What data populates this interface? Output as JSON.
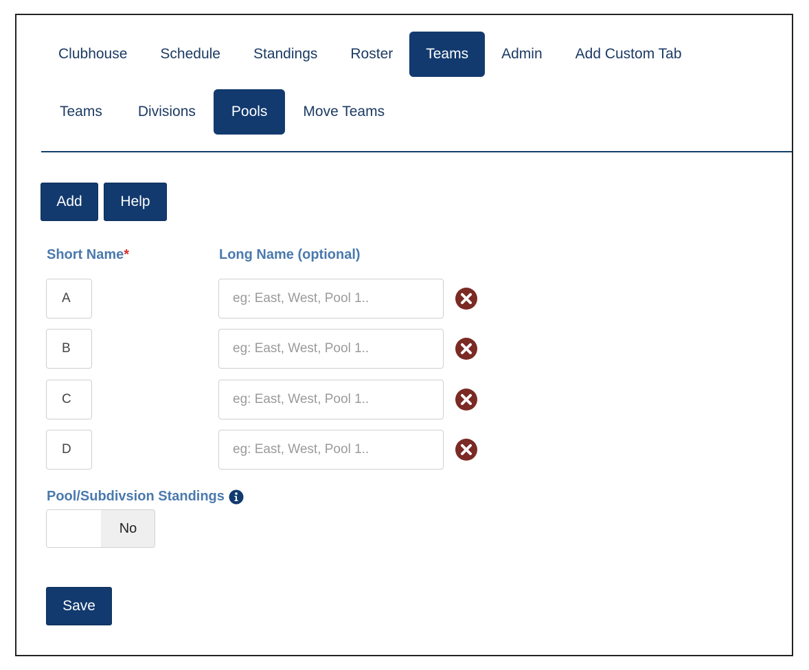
{
  "main_tabs": [
    {
      "label": "Clubhouse",
      "active": false
    },
    {
      "label": "Schedule",
      "active": false
    },
    {
      "label": "Standings",
      "active": false
    },
    {
      "label": "Roster",
      "active": false
    },
    {
      "label": "Teams",
      "active": true
    },
    {
      "label": "Admin",
      "active": false
    },
    {
      "label": "Add Custom Tab",
      "active": false
    }
  ],
  "sub_tabs": [
    {
      "label": "Teams",
      "active": false
    },
    {
      "label": "Divisions",
      "active": false
    },
    {
      "label": "Pools",
      "active": true
    },
    {
      "label": "Move Teams",
      "active": false
    }
  ],
  "toolbar": {
    "add_label": "Add",
    "help_label": "Help"
  },
  "columns": {
    "short_name": "Short Name",
    "required_mark": "*",
    "long_name": "Long Name (optional)"
  },
  "pools": [
    {
      "short": "A",
      "long": "",
      "placeholder": "eg: East, West, Pool 1.."
    },
    {
      "short": "B",
      "long": "",
      "placeholder": "eg: East, West, Pool 1.."
    },
    {
      "short": "C",
      "long": "",
      "placeholder": "eg: East, West, Pool 1.."
    },
    {
      "short": "D",
      "long": "",
      "placeholder": "eg: East, West, Pool 1.."
    }
  ],
  "standings": {
    "label": "Pool/Subdivsion Standings",
    "toggle_value": "No",
    "info_icon": "info-circle-icon"
  },
  "save_label": "Save",
  "colors": {
    "primary": "#123a6e",
    "label_blue": "#4a79ad",
    "remove_red": "#7b2a24",
    "required_red": "#d32f2f"
  }
}
